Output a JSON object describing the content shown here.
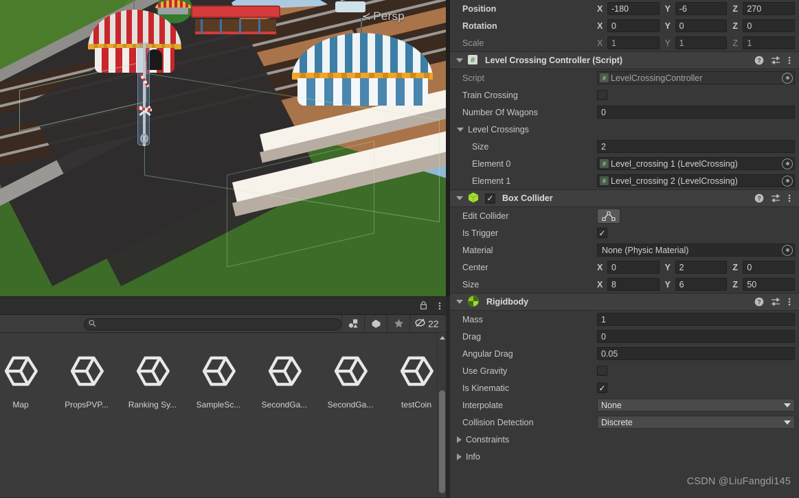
{
  "scene_view": {
    "camera_label": "Persp",
    "back_arrow": "←"
  },
  "project_panel": {
    "search_placeholder": "",
    "search_value": "",
    "toolbar_icons": [
      "asset-type-filter-icon",
      "label-filter-icon",
      "favorite-filter-icon"
    ],
    "hidden_count": "22",
    "hidden_icon": "hidden-assets-icon",
    "lock_icon": "lock-icon",
    "menu_icon": "kebab-menu-icon",
    "assets": [
      {
        "label": "Map",
        "icon": "unity-prefab-icon"
      },
      {
        "label": "PropsPVP...",
        "icon": "unity-prefab-icon"
      },
      {
        "label": "Ranking Sy...",
        "icon": "unity-prefab-icon"
      },
      {
        "label": "SampleSc...",
        "icon": "unity-prefab-icon"
      },
      {
        "label": "SecondGa...",
        "icon": "unity-prefab-icon"
      },
      {
        "label": "SecondGa...",
        "icon": "unity-prefab-icon"
      },
      {
        "label": "testCoin",
        "icon": "unity-prefab-icon"
      }
    ]
  },
  "inspector": {
    "transform": {
      "rows": [
        {
          "label": "Position",
          "bold": true,
          "dim": false,
          "x": "-180",
          "y": "-6",
          "z": "270"
        },
        {
          "label": "Rotation",
          "bold": true,
          "dim": false,
          "x": "0",
          "y": "0",
          "z": "0"
        },
        {
          "label": "Scale",
          "bold": false,
          "dim": true,
          "x": "1",
          "y": "1",
          "z": "1"
        }
      ],
      "axis_labels": [
        "X",
        "Y",
        "Z"
      ]
    },
    "components": [
      {
        "name": "script-component",
        "title": "Level Crossing Controller (Script)",
        "icon": "script-icon",
        "has_checkbox": false,
        "fields": [
          {
            "type": "object",
            "label": "Script",
            "value": "LevelCrossingController",
            "disabled": true
          },
          {
            "type": "checkbox",
            "label": "Train Crossing",
            "checked": false
          },
          {
            "type": "text",
            "label": "Number Of Wagons",
            "value": "0"
          },
          {
            "type": "foldout-open",
            "label": "Level Crossings"
          },
          {
            "type": "text",
            "label": "Size",
            "value": "2",
            "indent": true
          },
          {
            "type": "object",
            "label": "Element 0",
            "value": "Level_crossing 1 (LevelCrossing)",
            "indent": true,
            "disabled": false
          },
          {
            "type": "object",
            "label": "Element 1",
            "value": "Level_crossing 2 (LevelCrossing)",
            "indent": true,
            "disabled": false
          }
        ]
      },
      {
        "name": "box-collider-component",
        "title": "Box Collider",
        "icon": "box-collider-icon",
        "has_checkbox": true,
        "checked": true,
        "fields": [
          {
            "type": "edit-collider",
            "label": "Edit Collider",
            "button_icon": "edit-collider-icon"
          },
          {
            "type": "checkbox",
            "label": "Is Trigger",
            "checked": true
          },
          {
            "type": "object-plain",
            "label": "Material",
            "value": "None (Physic Material)"
          },
          {
            "type": "vector3",
            "label": "Center",
            "x": "0",
            "y": "2",
            "z": "0"
          },
          {
            "type": "vector3",
            "label": "Size",
            "x": "8",
            "y": "6",
            "z": "50"
          }
        ]
      },
      {
        "name": "rigidbody-component",
        "title": "Rigidbody",
        "icon": "rigidbody-icon",
        "has_checkbox": false,
        "fields": [
          {
            "type": "text",
            "label": "Mass",
            "value": "1"
          },
          {
            "type": "text",
            "label": "Drag",
            "value": "0"
          },
          {
            "type": "text",
            "label": "Angular Drag",
            "value": "0.05"
          },
          {
            "type": "checkbox",
            "label": "Use Gravity",
            "checked": false
          },
          {
            "type": "checkbox",
            "label": "Is Kinematic",
            "checked": true
          },
          {
            "type": "dropdown",
            "label": "Interpolate",
            "value": "None"
          },
          {
            "type": "dropdown",
            "label": "Collision Detection",
            "value": "Discrete"
          },
          {
            "type": "foldout-closed",
            "label": "Constraints"
          },
          {
            "type": "foldout-closed",
            "label": "Info"
          }
        ]
      }
    ],
    "header_icons": {
      "help": "help-icon",
      "preset": "preset-icon",
      "menu": "kebab-menu-icon"
    }
  },
  "watermark": "CSDN @LiuFangdi145",
  "colors": {
    "panel_bg": "#383838",
    "header_bg": "#3f3f3f",
    "field_bg": "#2a2a2a",
    "dropdown_bg": "#4a4a4a",
    "accent_green": "#8fd018",
    "text": "#c8c8c8"
  }
}
